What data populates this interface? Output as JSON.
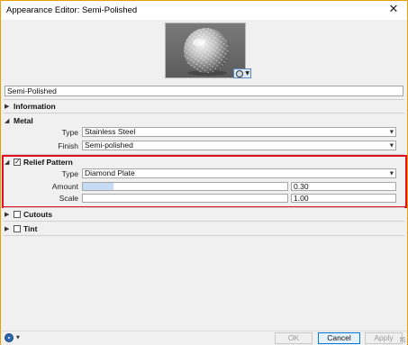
{
  "window": {
    "title": "Appearance Editor: Semi-Polished",
    "close_icon": "close-icon",
    "frame_color": "#e8a100"
  },
  "preview": {
    "thumbnail": "metal-sphere-preview",
    "button_icon": "magnifier-icon"
  },
  "appearance_name": "Semi-Polished",
  "sections": {
    "information": {
      "label": "Information",
      "expanded": false
    },
    "metal": {
      "label": "Metal",
      "expanded": true,
      "type_label": "Type",
      "type_value": "Stainless Steel",
      "finish_label": "Finish",
      "finish_value": "Semi-polished"
    },
    "relief": {
      "label": "Relief Pattern",
      "expanded": true,
      "checked": true,
      "type_label": "Type",
      "type_value": "Diamond Plate",
      "amount_label": "Amount",
      "amount_value": "0.30",
      "amount_fraction": 0.15,
      "scale_label": "Scale",
      "scale_value": "1.00",
      "scale_fraction": 0.0
    },
    "cutouts": {
      "label": "Cutouts",
      "expanded": false,
      "checked": false
    },
    "tint": {
      "label": "Tint",
      "expanded": false,
      "checked": false
    }
  },
  "highlight_color": "#e3101f",
  "footer": {
    "help_icon": "help-icon",
    "ok_label": "OK",
    "cancel_label": "Cancel",
    "apply_label": "Apply"
  }
}
